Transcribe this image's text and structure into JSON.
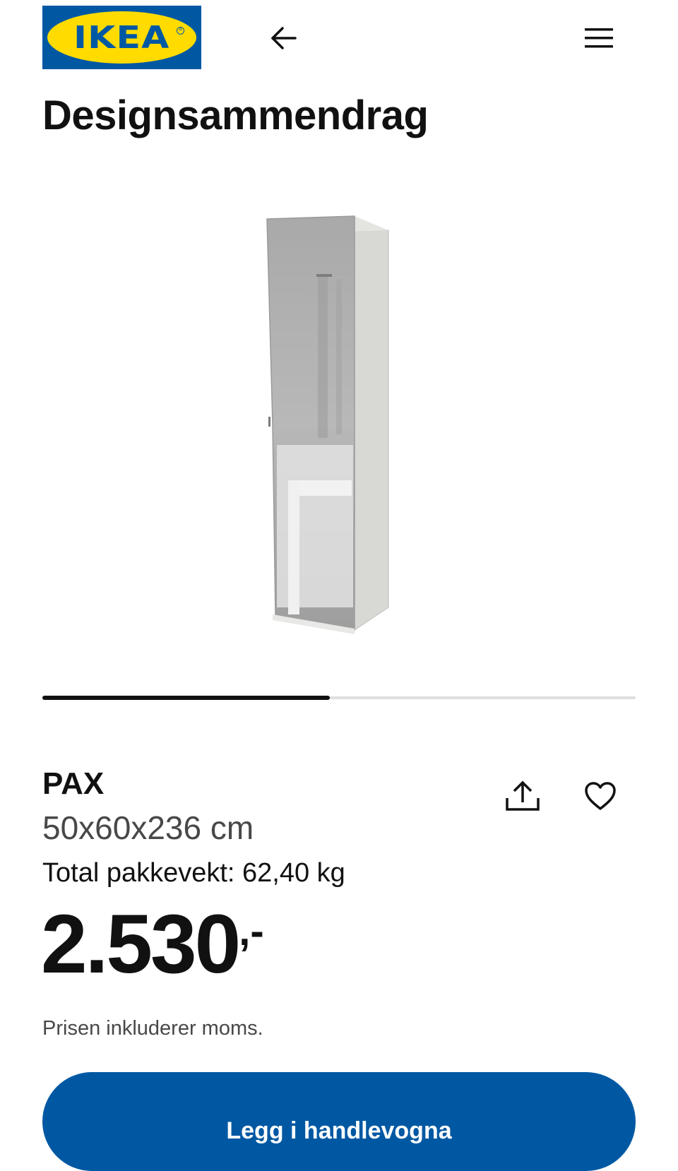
{
  "header": {
    "logo_text": "IKEA",
    "back_icon": "arrow-left-icon",
    "menu_icon": "hamburger-menu-icon"
  },
  "page": {
    "title": "Designsammendrag"
  },
  "carousel": {
    "progress": 0.485
  },
  "product": {
    "name": "PAX",
    "dimensions": "50x60x236 cm",
    "weight": "Total pakkevekt: 62,40 kg",
    "price_integer": "2.530",
    "price_suffix": ",-",
    "vat_note": "Prisen inkluderer moms.",
    "share_icon": "share-upload-icon",
    "favorite_icon": "heart-icon"
  },
  "actions": {
    "add_to_cart_label": "Legg i handlevogna"
  },
  "colors": {
    "brand_blue": "#0058a3",
    "brand_yellow": "#ffdb00",
    "text_primary": "#111111",
    "text_secondary": "#484848"
  }
}
